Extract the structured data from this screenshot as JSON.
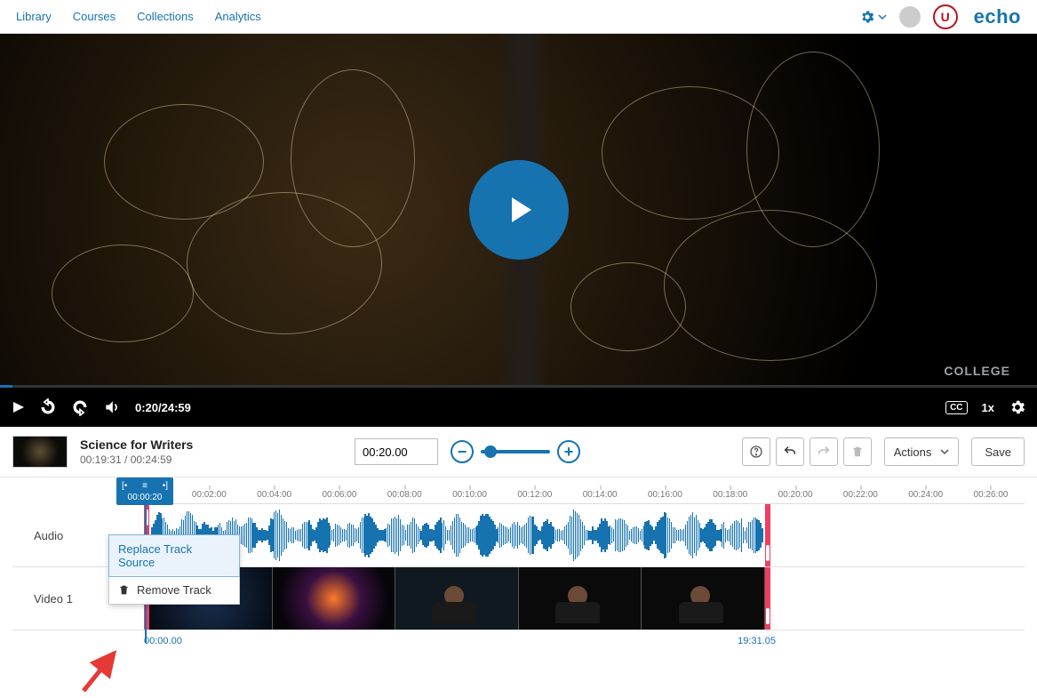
{
  "nav": {
    "library": "Library",
    "courses": "Courses",
    "collections": "Collections",
    "analytics": "Analytics",
    "brand": "echo"
  },
  "player": {
    "watermark": "COLLEGE",
    "time_display": "0:20/24:59",
    "speed": "1x",
    "cc": "CC"
  },
  "project": {
    "title": "Science for Writers",
    "subtitle": "00:19:31 / 00:24:59",
    "time_input": "00:20.00"
  },
  "toolbar": {
    "actions_label": "Actions",
    "save_label": "Save"
  },
  "timeline": {
    "playhead_time": "00:00:20",
    "ticks": [
      "00:02:00",
      "00:04:00",
      "00:06:00",
      "00:08:00",
      "00:10:00",
      "00:12:00",
      "00:14:00",
      "00:16:00",
      "00:18:00",
      "00:20:00",
      "00:22:00",
      "00:24:00",
      "00:26:00"
    ],
    "tracks": {
      "audio": "Audio",
      "video1": "Video 1"
    },
    "start_label": "00:00.00",
    "end_label": "19:31.05"
  },
  "menu": {
    "replace": "Replace Track Source",
    "remove": "Remove Track"
  }
}
